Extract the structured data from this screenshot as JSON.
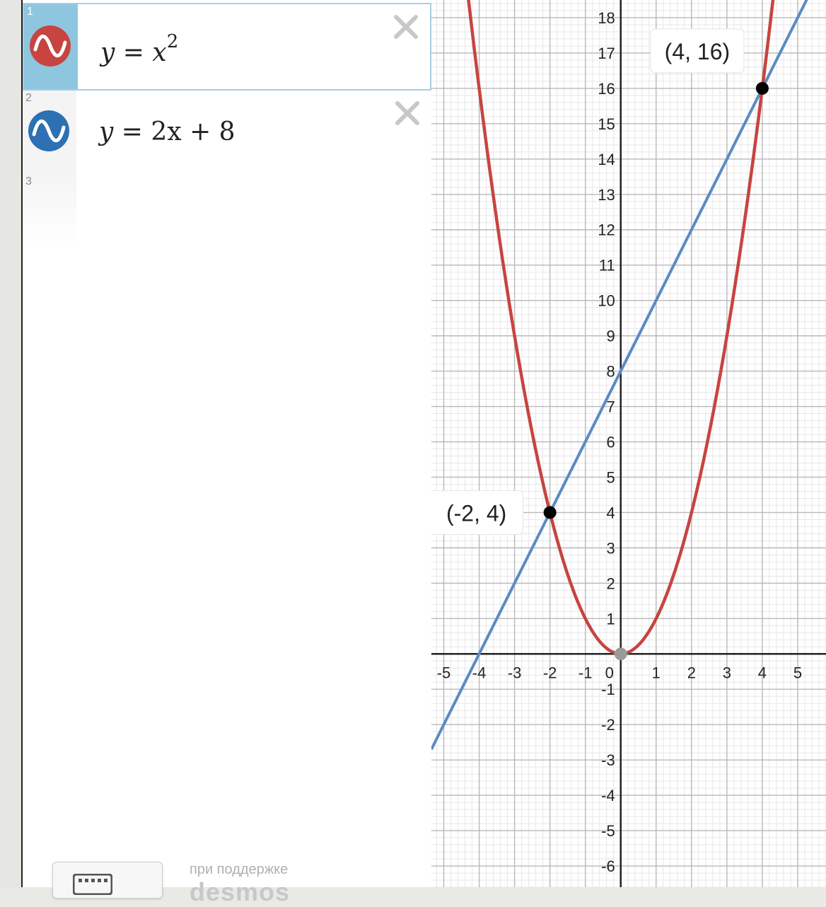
{
  "expressions": [
    {
      "index": "1",
      "y": "y",
      "eq": "=",
      "rhs_var": "x",
      "rhs_exp": "2",
      "color": "#c74440",
      "active": true
    },
    {
      "index": "2",
      "y": "y",
      "eq": "=",
      "rhs": "2x + 8",
      "color": "#2d70b3",
      "active": false
    },
    {
      "index": "3"
    }
  ],
  "footer": {
    "powered_by": "при поддержке",
    "logo": "desmos"
  },
  "graph": {
    "x_ticks": [
      "-5",
      "-4",
      "-3",
      "-2",
      "-1",
      "0",
      "1",
      "2",
      "3",
      "4",
      "5"
    ],
    "y_ticks_pos": [
      "1",
      "2",
      "3",
      "4",
      "5",
      "6",
      "7",
      "8",
      "9",
      "10",
      "11",
      "12",
      "13",
      "14",
      "15",
      "16",
      "17",
      "18"
    ],
    "y_ticks_neg": [
      "-1",
      "-2",
      "-3",
      "-4",
      "-5",
      "-6"
    ],
    "x_range": [
      -5.35,
      5.8
    ],
    "y_range": [
      -6.6,
      18.5
    ],
    "curves": [
      {
        "name": "y = x^2",
        "color": "#c74440"
      },
      {
        "name": "y = 2x + 8",
        "color": "#5b8cc0"
      }
    ],
    "points": [
      {
        "x": -2,
        "y": 4,
        "label": "(-2, 4)"
      },
      {
        "x": 4,
        "y": 16,
        "label": "(4, 16)"
      },
      {
        "x": 0,
        "y": 0,
        "label": ""
      }
    ]
  }
}
